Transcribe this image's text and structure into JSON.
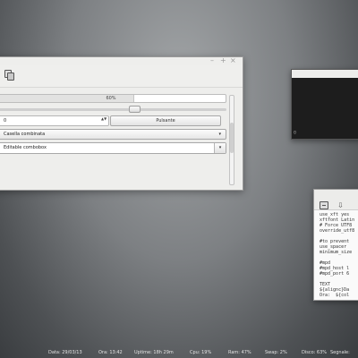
{
  "demo_window": {
    "controls": {
      "minimize": "–",
      "maximize": "+",
      "close": "×"
    },
    "toolbar": {
      "icon": "copy-icon"
    },
    "progress": {
      "value": 0.6,
      "label": "60%"
    },
    "slider": {
      "value": 0.6
    },
    "spinbox": {
      "value": "0",
      "arrows": "▲▼"
    },
    "push_button": {
      "label": "Pulsante"
    },
    "combobox": {
      "value": "Casella combinata",
      "arrow": "▾"
    },
    "editable_combobox": {
      "value": "Editable combobox",
      "arrow": "▾"
    }
  },
  "terminal_window": {
    "prompt": "▯"
  },
  "editor_window": {
    "icons": [
      "terminal-icon",
      "download-icon"
    ],
    "icon_glyphs": {
      "download": "⇩"
    },
    "lines": [
      "use_xft yes",
      "xftfont Latin",
      "# Force UTF8",
      "override_utf8",
      "",
      "#to prevent",
      "use_spacer",
      "minimum_size",
      "",
      "#mpd",
      "#mpd_host l",
      "#mpd_port 6",
      "",
      "TEXT",
      "${alignc}Da",
      "Ora:  ${col"
    ]
  },
  "statusbar": {
    "items": [
      "Data: 29/03/13",
      "Ora: 13:42",
      "Uptime: 18h 29m",
      "Cpu: 19%",
      "Ram: 47%",
      "Swap: 2%",
      "Disco: 63%",
      "Segnale:"
    ]
  }
}
